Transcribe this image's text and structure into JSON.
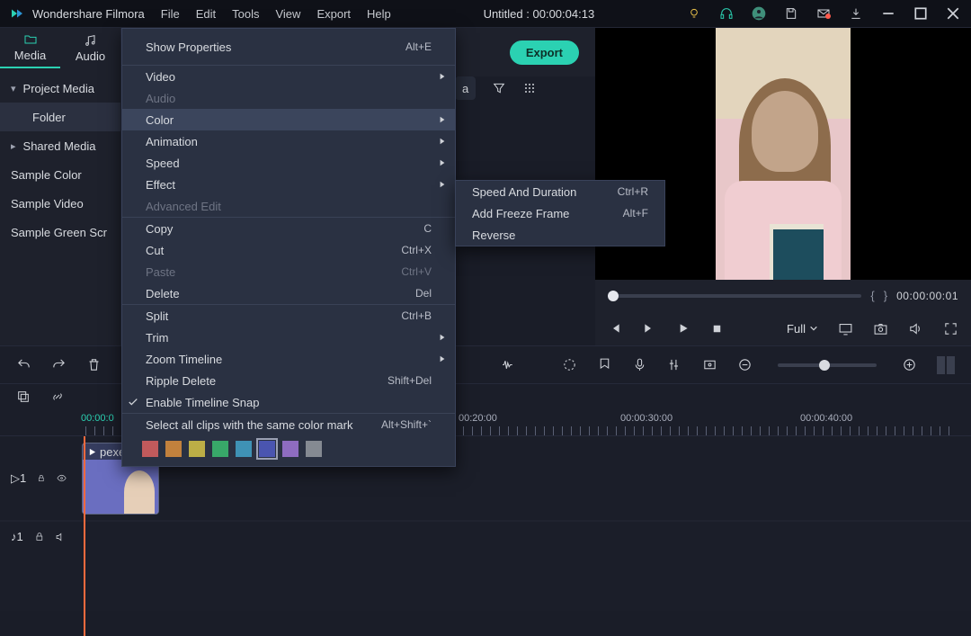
{
  "appname": "Wondershare Filmora",
  "menu": [
    "File",
    "Edit",
    "Tools",
    "View",
    "Export",
    "Help"
  ],
  "title_doc": "Untitled",
  "title_time": "00:00:04:13",
  "tabs": {
    "media": "Media",
    "audio": "Audio"
  },
  "tree": {
    "project": "Project Media",
    "folder": "Folder",
    "shared": "Shared Media",
    "s1": "Sample Color",
    "s2": "Sample Video",
    "s3": "Sample Green Scr"
  },
  "export_btn": "Export",
  "search_placeholder": "a",
  "context": {
    "show_props": "Show Properties",
    "show_props_sc": "Alt+E",
    "video": "Video",
    "audio": "Audio",
    "color": "Color",
    "animation": "Animation",
    "speed": "Speed",
    "effect": "Effect",
    "advanced": "Advanced Edit",
    "copy": "Copy",
    "copy_sc": "C",
    "cut": "Cut",
    "cut_sc": "Ctrl+X",
    "paste": "Paste",
    "paste_sc": "Ctrl+V",
    "delete": "Delete",
    "delete_sc": "Del",
    "split": "Split",
    "split_sc": "Ctrl+B",
    "trim": "Trim",
    "zoom": "Zoom Timeline",
    "ripple": "Ripple Delete",
    "ripple_sc": "Shift+Del",
    "snap": "Enable Timeline Snap",
    "selectcolor": "Select all clips with the same color mark",
    "selectcolor_sc": "Alt+Shift+`",
    "colors": [
      "#c15a5c",
      "#c2813d",
      "#bcae46",
      "#38a869",
      "#3f92b5",
      "#4a55b0",
      "#8e6cc0",
      "#858a92"
    ],
    "color_sel": 5
  },
  "speed_sub": {
    "i0": "Speed And Duration",
    "i0sc": "Ctrl+R",
    "i1": "Add Freeze Frame",
    "i1sc": "Alt+F",
    "i2": "Reverse"
  },
  "preview": {
    "timecode": "00:00:00:01",
    "fit": "Full"
  },
  "ruler": {
    "t0": "00:00:0",
    "t1": "00:20:00",
    "t2": "00:00:30:00",
    "t3": "00:00:40:00"
  },
  "clip_label": "pexe",
  "track_v": "1",
  "track_a": "1"
}
